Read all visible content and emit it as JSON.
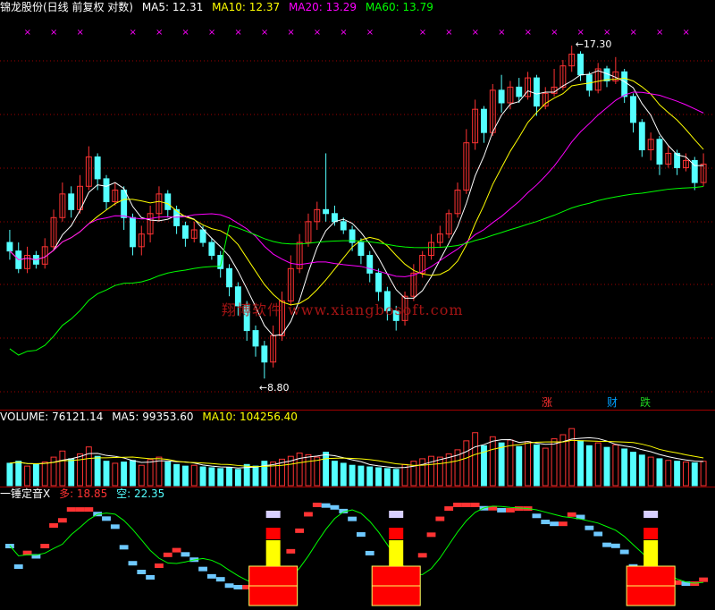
{
  "price_header": {
    "title": "锦龙股份(日线 前复权 对数)",
    "ma5": "MA5: 12.31",
    "ma10": "MA10: 12.37",
    "ma20": "MA20: 13.29",
    "ma60": "MA60: 13.79"
  },
  "price_annotations": {
    "high_label": "17.30",
    "low_label": "8.80"
  },
  "event_badges": [
    {
      "label": "涨",
      "color": "#ff3030"
    },
    {
      "label": "财",
      "color": "#00a0ff"
    },
    {
      "label": "跌",
      "color": "#20d020"
    }
  ],
  "watermark": "翔博软件 www.xiangbosoft.com",
  "volume_header": {
    "volume": "VOLUME: 76121.14",
    "ma5": "MA5: 99353.60",
    "ma10": "MA10: 104256.40"
  },
  "indicator_header": {
    "name": "一锤定音X",
    "long": "多: 18.85",
    "short": "空: 22.35"
  },
  "colors": {
    "up": "#ff3333",
    "down": "#54ffff",
    "ma5": "#ffffff",
    "ma10": "#ffff00",
    "ma20": "#ff00ff",
    "ma60": "#00ff00",
    "grid": "#a00000",
    "signal_mark": "#ff00ff"
  },
  "chart_data": {
    "type": "candlestick",
    "price_range": [
      8.8,
      17.3
    ],
    "candles": [
      [
        11.6,
        11.4,
        11.9,
        11.2
      ],
      [
        11.4,
        11.0,
        11.6,
        10.9
      ],
      [
        11.0,
        11.3,
        11.5,
        10.9
      ],
      [
        11.3,
        11.1,
        11.4,
        11.0
      ],
      [
        11.1,
        11.5,
        11.7,
        11.0
      ],
      [
        11.5,
        12.2,
        12.4,
        11.4
      ],
      [
        12.2,
        12.8,
        13.1,
        12.1
      ],
      [
        12.8,
        12.4,
        13.0,
        12.2
      ],
      [
        12.4,
        13.0,
        13.3,
        12.3
      ],
      [
        13.0,
        13.8,
        14.1,
        12.9
      ],
      [
        13.8,
        13.2,
        13.9,
        12.9
      ],
      [
        13.2,
        12.6,
        13.3,
        12.4
      ],
      [
        12.6,
        12.9,
        13.1,
        12.5
      ],
      [
        12.9,
        12.2,
        13.0,
        11.9
      ],
      [
        12.2,
        11.5,
        12.3,
        11.3
      ],
      [
        11.5,
        11.8,
        12.0,
        11.3
      ],
      [
        11.8,
        12.3,
        12.5,
        11.6
      ],
      [
        12.3,
        12.8,
        13.0,
        12.1
      ],
      [
        12.8,
        12.4,
        12.9,
        12.2
      ],
      [
        12.4,
        12.0,
        12.5,
        11.8
      ],
      [
        12.0,
        11.7,
        12.1,
        11.5
      ],
      [
        11.7,
        11.9,
        12.1,
        11.6
      ],
      [
        11.9,
        11.6,
        12.0,
        11.5
      ],
      [
        11.6,
        11.3,
        11.7,
        11.2
      ],
      [
        11.3,
        11.0,
        11.4,
        10.8
      ],
      [
        11.0,
        10.6,
        11.1,
        10.4
      ],
      [
        10.6,
        10.2,
        10.7,
        10.0
      ],
      [
        10.2,
        9.7,
        10.3,
        9.5
      ],
      [
        9.7,
        9.4,
        9.8,
        9.2
      ],
      [
        9.4,
        9.1,
        9.5,
        8.8
      ],
      [
        9.1,
        9.6,
        9.8,
        9.0
      ],
      [
        9.6,
        10.3,
        10.5,
        9.5
      ],
      [
        10.3,
        11.0,
        11.3,
        10.2
      ],
      [
        11.0,
        11.6,
        11.8,
        10.9
      ],
      [
        11.6,
        12.1,
        12.3,
        11.5
      ],
      [
        12.1,
        12.4,
        12.6,
        11.9
      ],
      [
        12.4,
        12.3,
        13.9,
        12.1
      ],
      [
        12.3,
        12.1,
        12.5,
        12.0
      ],
      [
        12.1,
        11.9,
        12.2,
        11.8
      ],
      [
        11.9,
        11.6,
        12.0,
        11.4
      ],
      [
        11.6,
        11.3,
        11.7,
        11.1
      ],
      [
        11.3,
        10.9,
        11.4,
        10.7
      ],
      [
        10.9,
        10.5,
        11.0,
        10.3
      ],
      [
        10.5,
        10.1,
        10.6,
        9.9
      ],
      [
        10.1,
        9.9,
        10.2,
        9.7
      ],
      [
        9.9,
        10.4,
        10.5,
        9.8
      ],
      [
        10.4,
        10.9,
        11.1,
        10.3
      ],
      [
        10.9,
        11.3,
        11.4,
        10.8
      ],
      [
        11.3,
        11.6,
        11.8,
        11.2
      ],
      [
        11.6,
        11.8,
        12.0,
        11.5
      ],
      [
        11.8,
        12.3,
        12.4,
        11.7
      ],
      [
        12.3,
        12.9,
        13.1,
        12.2
      ],
      [
        12.9,
        14.2,
        14.6,
        12.8
      ],
      [
        14.2,
        15.2,
        15.5,
        14.0
      ],
      [
        15.2,
        14.5,
        15.3,
        14.2
      ],
      [
        14.5,
        15.8,
        16.0,
        14.4
      ],
      [
        15.8,
        15.4,
        16.3,
        15.1
      ],
      [
        15.4,
        15.9,
        16.1,
        15.2
      ],
      [
        15.9,
        15.6,
        16.2,
        15.4
      ],
      [
        15.6,
        16.2,
        16.4,
        15.5
      ],
      [
        16.2,
        15.3,
        16.3,
        15.0
      ],
      [
        15.3,
        15.7,
        15.9,
        15.2
      ],
      [
        15.7,
        15.9,
        16.5,
        15.6
      ],
      [
        15.9,
        16.6,
        16.8,
        15.8
      ],
      [
        16.6,
        17.0,
        17.3,
        16.4
      ],
      [
        17.0,
        16.3,
        17.1,
        16.1
      ],
      [
        16.3,
        15.8,
        16.4,
        15.6
      ],
      [
        15.8,
        16.5,
        16.7,
        15.7
      ],
      [
        16.5,
        16.1,
        16.6,
        15.9
      ],
      [
        16.1,
        16.4,
        16.9,
        16.0
      ],
      [
        16.4,
        15.6,
        16.5,
        15.4
      ],
      [
        15.6,
        14.8,
        15.7,
        14.5
      ],
      [
        14.8,
        14.0,
        14.9,
        13.8
      ],
      [
        14.0,
        14.3,
        14.5,
        13.7
      ],
      [
        14.3,
        13.6,
        14.4,
        13.3
      ],
      [
        13.6,
        13.9,
        14.1,
        13.5
      ],
      [
        13.9,
        13.5,
        14.0,
        13.3
      ],
      [
        13.5,
        13.7,
        13.9,
        13.4
      ],
      [
        13.7,
        13.1,
        13.8,
        12.9
      ],
      [
        13.1,
        13.6,
        13.9,
        13.0
      ]
    ],
    "volumes": [
      55,
      60,
      48,
      52,
      58,
      70,
      85,
      66,
      78,
      95,
      72,
      60,
      55,
      58,
      62,
      50,
      64,
      70,
      58,
      52,
      48,
      50,
      46,
      44,
      42,
      45,
      40,
      52,
      48,
      60,
      58,
      65,
      72,
      80,
      76,
      70,
      82,
      60,
      55,
      50,
      48,
      46,
      44,
      42,
      40,
      52,
      60,
      66,
      72,
      70,
      78,
      88,
      110,
      130,
      98,
      120,
      105,
      112,
      96,
      108,
      100,
      92,
      115,
      125,
      140,
      110,
      98,
      105,
      94,
      100,
      90,
      82,
      75,
      70,
      66,
      62,
      60,
      58,
      56,
      60
    ]
  }
}
